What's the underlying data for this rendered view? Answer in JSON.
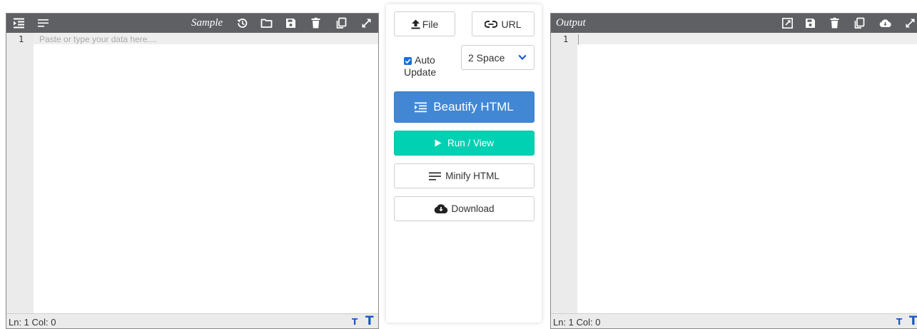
{
  "left_editor": {
    "title": "Sample",
    "line_number": "1",
    "placeholder": "Paste or type your data here....",
    "status": "Ln: 1 Col: 0",
    "toolbar_icons": [
      "indent-icon",
      "align-left-icon",
      "history-icon",
      "folder-icon",
      "save-icon",
      "trash-icon",
      "copy-icon",
      "expand-icon"
    ],
    "font_decrease_glyph": "T",
    "font_increase_glyph": "T"
  },
  "right_editor": {
    "title": "Output",
    "line_number": "1",
    "status": "Ln: 1 Col: 0",
    "toolbar_icons": [
      "external-link-icon",
      "save-icon",
      "trash-icon",
      "copy-icon",
      "cloud-download-icon",
      "expand-icon"
    ],
    "font_decrease_glyph": "T",
    "font_increase_glyph": "T"
  },
  "controls": {
    "file_label": "File",
    "url_label": "URL",
    "auto_update_label": "Auto Update",
    "auto_update_checked": true,
    "indent_selected": "2 Space",
    "beautify_label": "Beautify HTML",
    "run_label": "Run / View",
    "minify_label": "Minify HTML",
    "download_label": "Download"
  },
  "colors": {
    "toolbar_bg": "#5f6063",
    "beautify_bg": "#4287d4",
    "run_bg": "#00d1b2",
    "font_size_icons": "#1a56c2",
    "checkbox": "#1a6fd6"
  }
}
